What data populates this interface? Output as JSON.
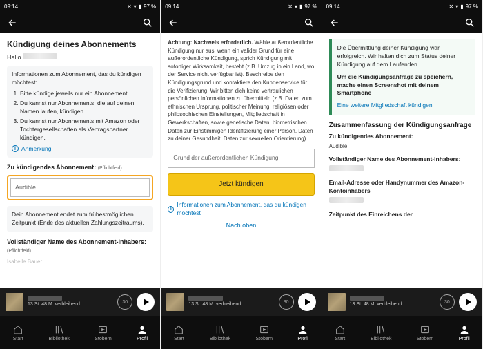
{
  "status": {
    "time": "09:14",
    "battery": "97 %"
  },
  "s1": {
    "title": "Kündigung deines Abonnements",
    "greeting": "Hallo",
    "info_head": "Informationen zum Abonnement, das du kündigen möchtest:",
    "li1": "Bitte kündige jeweils nur ein Abonnement",
    "li2": "Du kannst nur Abonnements, die auf deinen Namen laufen, kündigen.",
    "li3": "Du kannst nur Abonnements mit Amazon oder Tochtergesellschaften als Vertragspartner kündigen.",
    "note": "Anmerkung",
    "field_label": "Zu kündigendes Abonnement:",
    "required": "(Pflichtfeld)",
    "field_value": "Audible",
    "hint": "Dein Abonnement endet zum frühestmöglichen Zeitpunkt (Ende des aktuellen Zahlungszeitraums).",
    "owner_label": "Vollständiger Name des Abonnement-Inhabers:",
    "owner_value": "Isabelle Bauer"
  },
  "s2": {
    "warn_head": "Achtung: Nachweis erforderlich.",
    "warn_body": " Wähle außerordentliche Kündigung nur aus, wenn ein valider Grund für eine außerordentliche Kündigung, sprich Kündigung mit sofortiger Wirksamkeit, besteht (z.B. Umzug in ein Land, wo der Service nicht verfügbar ist). Beschreibe den Kündigungsgrund und kontaktiere den Kundenservice für die Verifizierung. Wir bitten dich keine vertraulichen persönlichen Informationen zu übermitteln (z.B. Daten zum ethnischen Ursprung, politischer Meinung, religiösen oder philosophischen Einstellungen, Mitgliedschaft in Gewerkschaften, sowie genetische Daten, biometrischen Daten zur Einstimmigen Identifizierung einer Person, Daten zu deiner Gesundheit, Daten zur sexuellen Orientierung).",
    "reason_placeholder": "Grund der außerordentlichen Kündigung",
    "btn": "Jetzt kündigen",
    "info_link": "Informationen zum Abonnement, das du kündigen möchtest",
    "top": "Nach oben"
  },
  "s3": {
    "success1": "Die Übermittlung deiner Kündigung war erfolgreich. Wir halten dich zum Status deiner Kündigung auf dem Laufenden.",
    "success2": "Um die Kündigungsanfrage zu speichern, mache einen Screenshot mit deinem Smartphone",
    "success3": "Eine weitere Mitgliedschaft kündigen",
    "summary_title": "Zusammenfassung der Kündigungsanfrage",
    "k1": "Zu kündigendes Abonnement:",
    "v1": "Audible",
    "k2": "Vollständiger Name des Abonnement-Inhabers:",
    "k3": "Email-Adresse oder Handynummer des Amazon-Kontoinhabers",
    "k4": "Zeitpunkt des Einreichens der"
  },
  "player": {
    "remaining": "13 St. 48 M. verbleibend",
    "rewind": "30"
  },
  "nav": {
    "start": "Start",
    "bib": "Bibliothek",
    "stob": "Stöbern",
    "profil": "Profil"
  }
}
